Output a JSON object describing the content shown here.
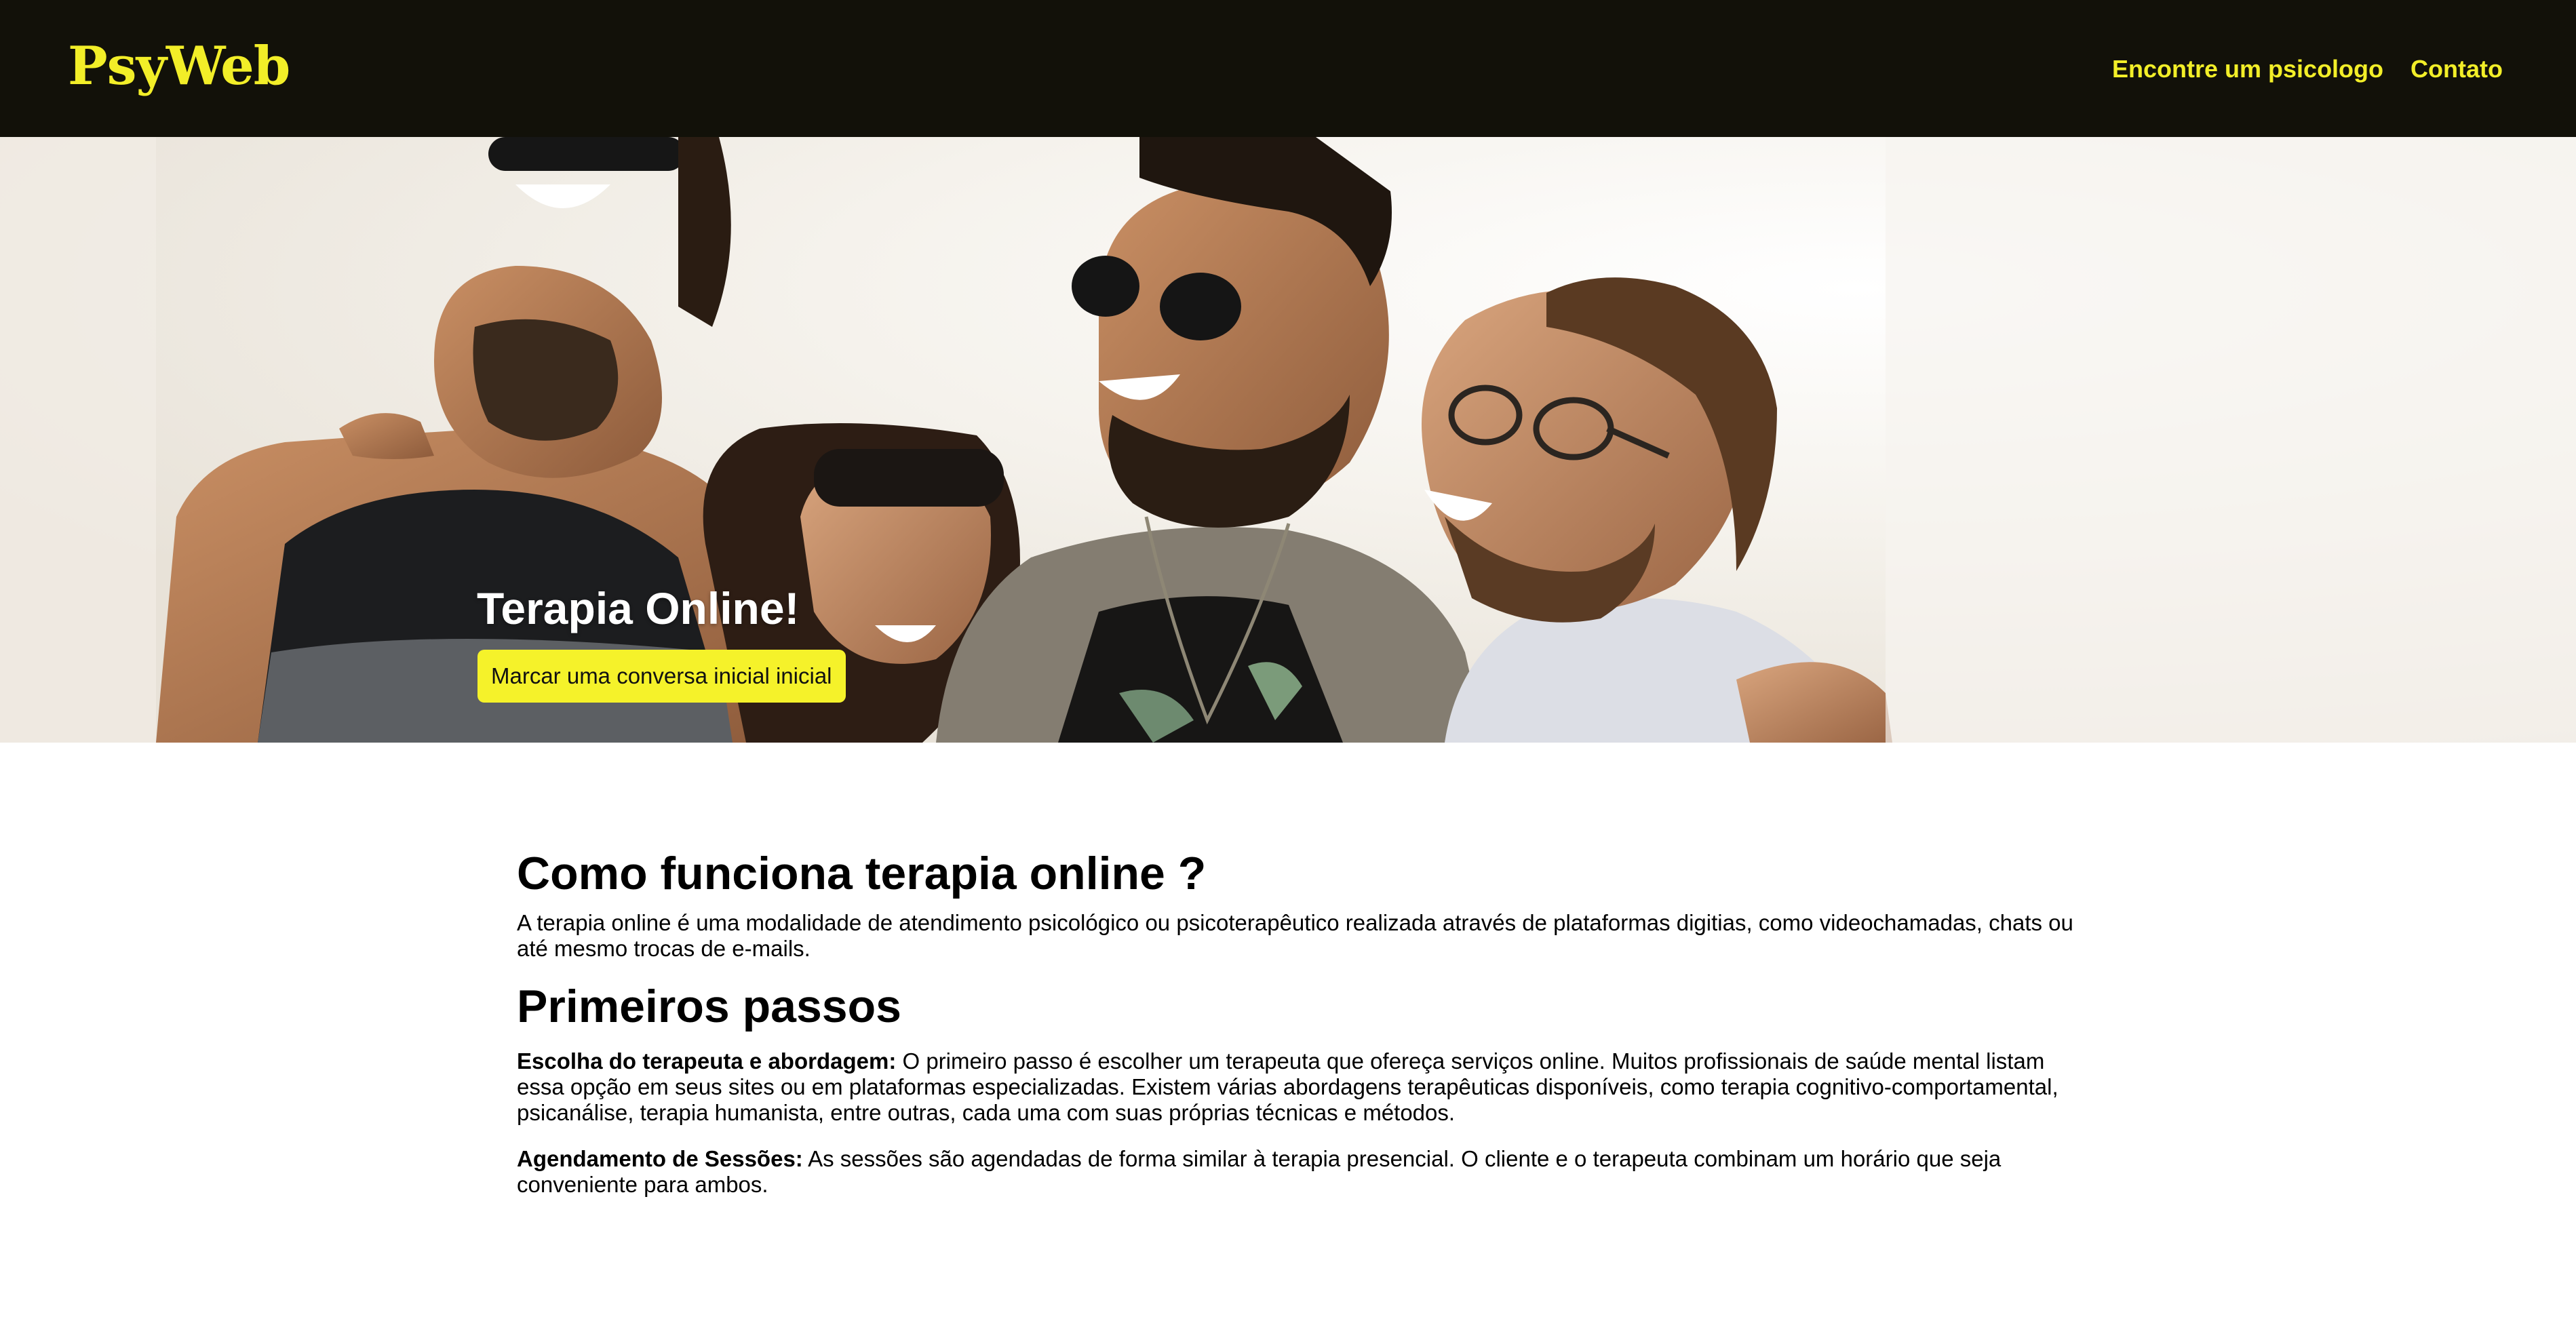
{
  "header": {
    "logo": "PsyWeb",
    "nav": [
      {
        "label": "Encontre um psicologo"
      },
      {
        "label": "Contato"
      }
    ]
  },
  "hero": {
    "title": "Terapia Online!",
    "cta_label": "Marcar uma conversa inicial inicial"
  },
  "main": {
    "section1": {
      "heading": "Como funciona terapia online ?",
      "text": "A terapia online é uma modalidade de atendimento psicológico ou psicoterapêutico realizada através de plataformas digitias, como videochamadas, chats ou até mesmo trocas de e-mails."
    },
    "section2": {
      "heading": "Primeiros passos",
      "items": [
        {
          "label": "Escolha do terapeuta e abordagem:",
          "text": " O primeiro passo é escolher um terapeuta que ofereça serviços online. Muitos profissionais de saúde mental listam essa opção em seus sites ou em plataformas especializadas. Existem várias abordagens terapêuticas disponíveis, como terapia cognitivo-comportamental, psicanálise, terapia humanista, entre outras, cada uma com suas próprias técnicas e métodos."
        },
        {
          "label": "Agendamento de Sessões:",
          "text": " As sessões são agendadas de forma similar à terapia presencial. O cliente e o terapeuta combinam um horário que seja conveniente para ambos."
        }
      ]
    }
  },
  "colors": {
    "header_bg": "#121109",
    "accent_yellow": "#f2ee28",
    "button_yellow": "#f5f22a",
    "text": "#000000"
  }
}
